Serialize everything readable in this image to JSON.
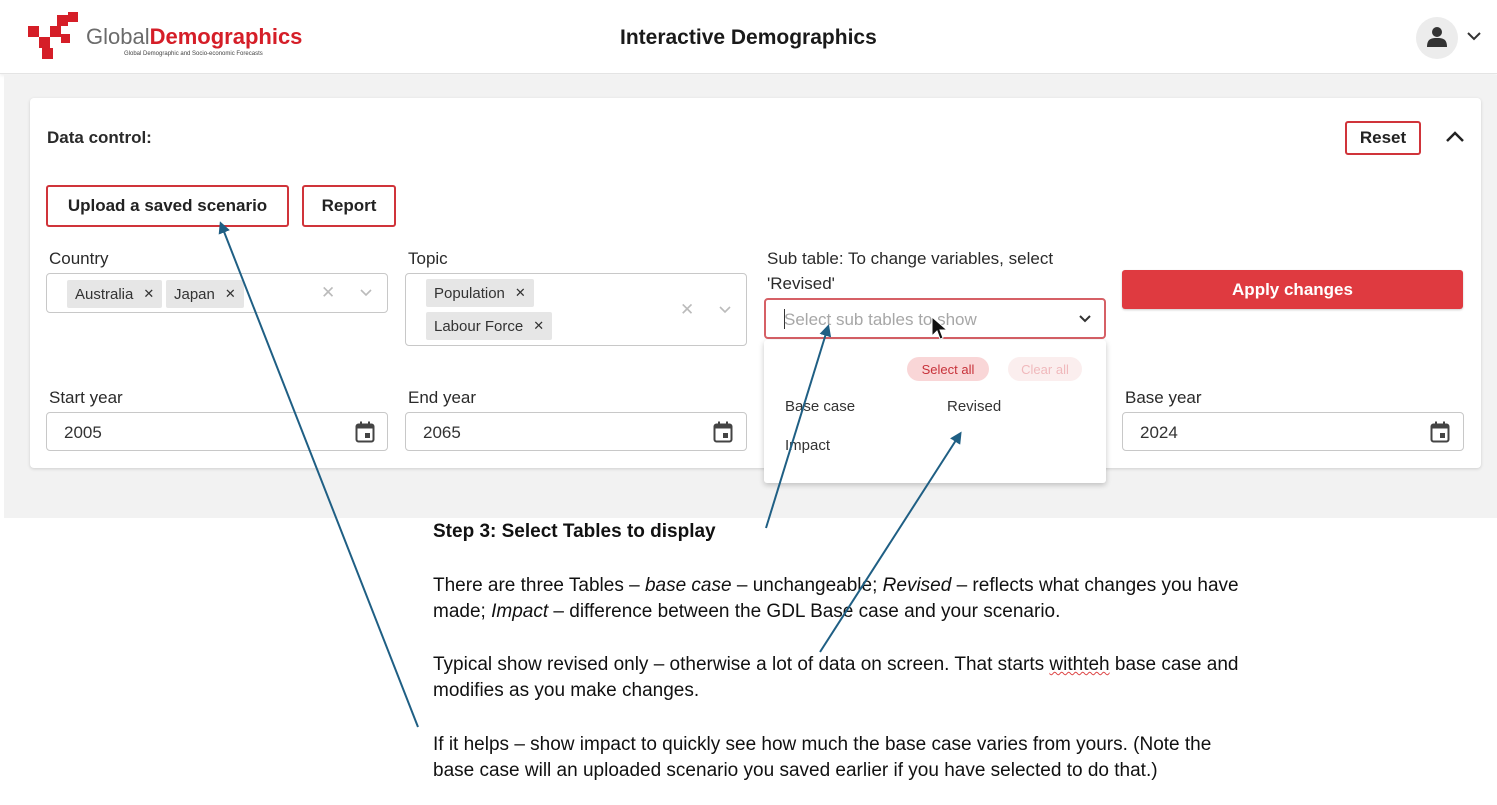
{
  "header": {
    "logo": {
      "brand_part1": "Global",
      "brand_part2": "Demographics",
      "tagline": "Global Demographic and Socio-economic Forecasts"
    },
    "title": "Interactive Demographics",
    "user_menu": {
      "icon": "user-icon",
      "chevron": "chevron-down-icon"
    }
  },
  "data_control": {
    "title": "Data control:",
    "reset_label": "Reset",
    "upload_label": "Upload a saved scenario",
    "report_label": "Report",
    "apply_label": "Apply changes",
    "country": {
      "label": "Country",
      "chips": [
        "Australia",
        "Japan"
      ]
    },
    "topic": {
      "label": "Topic",
      "chips": [
        "Population",
        "Labour Force"
      ]
    },
    "subtable": {
      "label_line1": "Sub table: To change variables, select",
      "label_line2": "'Revised'",
      "placeholder": "Select sub tables to show",
      "select_all": "Select all",
      "clear_all": "Clear all",
      "options": [
        "Base case",
        "Revised",
        "Impact"
      ]
    },
    "start_year": {
      "label": "Start year",
      "value": "2005"
    },
    "end_year": {
      "label": "End year",
      "value": "2065"
    },
    "base_year": {
      "label": "Base year",
      "value": "2024"
    }
  },
  "annotation": {
    "step_title": "Step 3:  Select Tables to display",
    "p1_a": "There are three Tables – ",
    "p1_b": "base case",
    "p1_c": " – unchangeable; ",
    "p1_d": "Revised",
    "p1_e": " – reflects what changes you have",
    "p1_f": "made; ",
    "p1_g": "Impact",
    "p1_h": " – difference between the GDL Base case and your scenario.",
    "p2_a": "Typical show revised only – otherwise a lot of data on screen.  That starts ",
    "p2_b": "withteh",
    "p2_c": " base case and",
    "p2_d": "modifies as you make changes.",
    "p3_a": "If it helps – show impact to quickly see how much the base case varies from yours. (Note the",
    "p3_b": "base case will an uploaded scenario you saved earlier if you have selected to do that.)"
  },
  "colors": {
    "accent": "#d51e28",
    "apply_bg": "#df3a40",
    "arrow": "#1f5f84"
  }
}
